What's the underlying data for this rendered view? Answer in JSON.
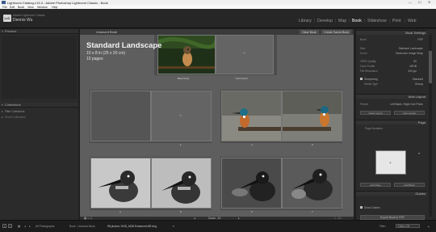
{
  "window": {
    "title": "Lightroom Catalog-v13-3 - Adobe Photoshop Lightroom Classic - Book",
    "controls": [
      "—",
      "☐",
      "✕"
    ]
  },
  "menu": [
    "File",
    "Edit",
    "Book",
    "View",
    "Window",
    "Help"
  ],
  "identity": {
    "logo": "LrC",
    "catalog": "Adobe Lightroom Classic",
    "user": "Dennis Wu"
  },
  "modules": [
    "Library",
    "Develop",
    "Map",
    "Book",
    "Slideshow",
    "Print",
    "Web"
  ],
  "active_module": "Book",
  "left_panel": {
    "preview_label": "Preview",
    "collections_label": "Collections",
    "collections": [
      "Filter Collections",
      "Smart Collections"
    ]
  },
  "center_toolbar": {
    "book_name": "Unsaved Book",
    "clear_book": "Clear Book",
    "create_saved_book": "Create Saved Book"
  },
  "book": {
    "title": "Standard Landscape",
    "size": "10 x 8 in (25 x 20 cm)",
    "pages": "10 pages",
    "back_cover": "Back Cover",
    "front_cover": "Front Cover",
    "page_numbers": [
      "1",
      "2",
      "3",
      "4",
      "5",
      "6",
      "7"
    ]
  },
  "right_panel": {
    "book_settings_label": "Book Settings",
    "book_settings": [
      {
        "label": "Book",
        "value": "PDF"
      },
      {
        "label": "Size",
        "value": "Standard Landscape"
      },
      {
        "label": "Cover",
        "value": "Hardcover Image Wrap"
      },
      {
        "label": "JPEG Quality",
        "value": "80"
      },
      {
        "label": "Color Profile",
        "value": "sRGB"
      },
      {
        "label": "File Resolution",
        "value": "300 ppi"
      },
      {
        "label": "Sharpening",
        "value": "Standard"
      },
      {
        "label": "Media Type",
        "value": "Glossy"
      }
    ],
    "auto_layout_label": "Auto Layout",
    "auto_layout_preset_label": "Preset:",
    "auto_layout_preset": "Left Blank, Right One Photo",
    "clear_layout": "Clear Layout",
    "auto_layout": "Auto Layout",
    "page_label": "Page",
    "page_numbers_label": "Page Numbers",
    "add_page": "Add Page",
    "add_blank": "Add Blank",
    "guides_label": "Guides",
    "guides_sub": "Show Guides",
    "export_button": "Export Book to PDF"
  },
  "center_bottom": {
    "zoom_label": "Cover - 10",
    "page_of": "1 - 10"
  },
  "status": {
    "page_buttons": [
      "1",
      "2"
    ],
    "source": "All Photographs",
    "path": "Book : Unsaved Book",
    "count": "98 photos / 8/28_1638 Enhanced-NR.dng",
    "filter_label": "Filter :",
    "filter_value": "Filters Off"
  }
}
